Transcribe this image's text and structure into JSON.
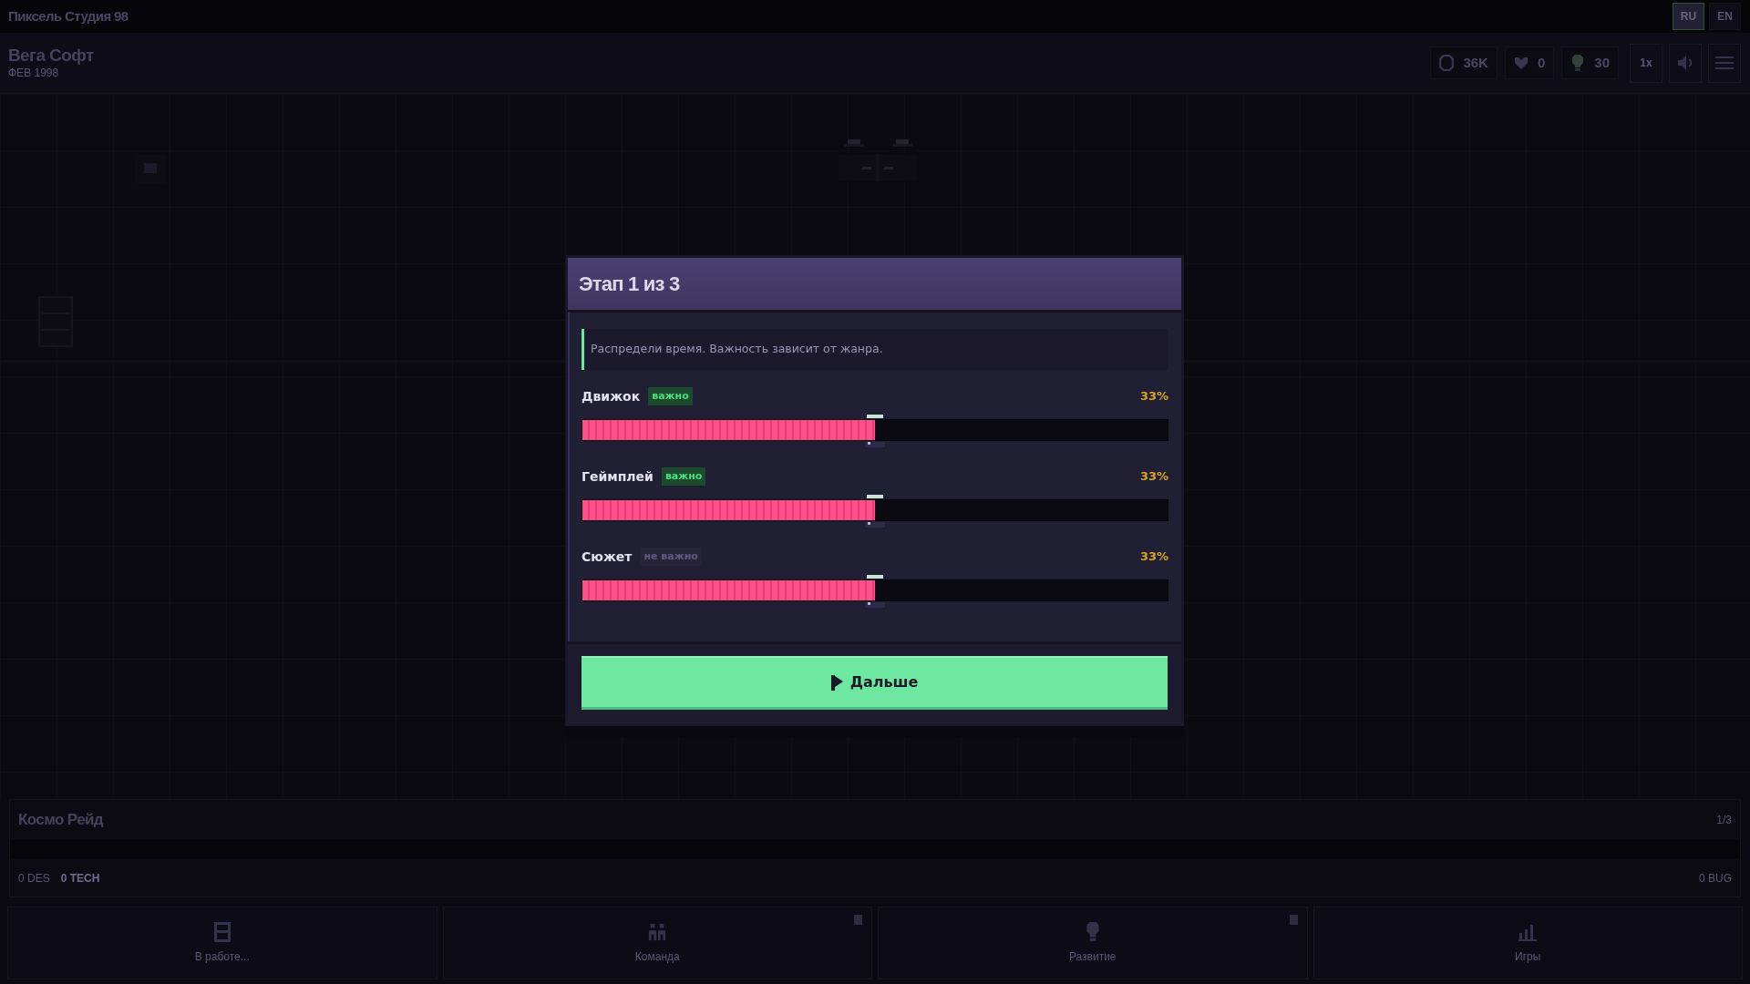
{
  "title_bar": {
    "title": "Пиксель Студия 98",
    "languages": [
      {
        "label": "RU",
        "selected": true
      },
      {
        "label": "EN",
        "selected": false
      }
    ]
  },
  "header": {
    "studio": "Вега Софт",
    "date": "ФЕВ 1998",
    "stats": [
      {
        "kind": "money",
        "value": "36K"
      },
      {
        "kind": "fans",
        "value": "0"
      },
      {
        "kind": "ideas",
        "value": "30"
      }
    ],
    "speed": "1x"
  },
  "dialog": {
    "title": "Этап 1 из 3",
    "hint": "Распредели время. Важность зависит от жанра.",
    "sliders": [
      {
        "label": "Движок",
        "tag": "важно",
        "important": true,
        "reading": "33%",
        "level": 0.5
      },
      {
        "label": "Геймплей",
        "tag": "важно",
        "important": true,
        "reading": "33%",
        "level": 0.5
      },
      {
        "label": "Сюжет",
        "tag": "не важно",
        "important": false,
        "reading": "33%",
        "level": 0.5
      }
    ],
    "button": "Дальше"
  },
  "project": {
    "name": "Космо Рейд",
    "stage": "1/3",
    "stats": [
      {
        "label": "0 DES",
        "highlighted": false
      },
      {
        "label": "0 TECH",
        "highlighted": true
      }
    ],
    "bugs": "0 BUG"
  },
  "nav": [
    {
      "label": "В работе...",
      "kind": "work",
      "notification": false
    },
    {
      "label": "Команда",
      "kind": "team",
      "notification": true
    },
    {
      "label": "Развитие",
      "kind": "research",
      "notification": true
    },
    {
      "label": "Игры",
      "kind": "games",
      "notification": false
    }
  ]
}
